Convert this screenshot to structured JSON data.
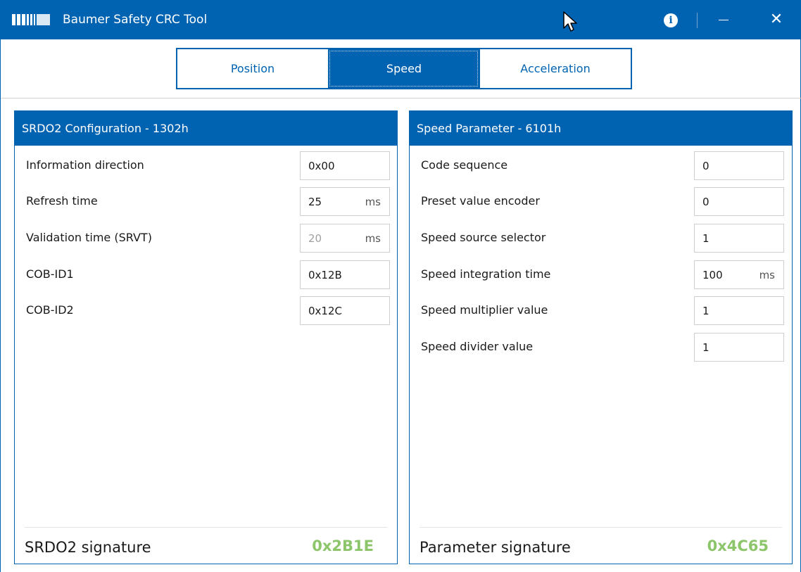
{
  "window": {
    "title": "Baumer Safety CRC Tool",
    "accent_color": "#0063b1",
    "icons": [
      "app-logo-icon",
      "info-icon",
      "minimize-icon",
      "close-icon",
      "mouse-cursor-icon"
    ]
  },
  "tabs": [
    {
      "label": "Position",
      "active": false
    },
    {
      "label": "Speed",
      "active": true
    },
    {
      "label": "Acceleration",
      "active": false
    }
  ],
  "left_panel": {
    "title": "SRDO2 Configuration - 1302h",
    "rows": [
      {
        "label": "Information direction",
        "value": "0x00",
        "unit": ""
      },
      {
        "label": "Refresh time",
        "value": "25",
        "unit": "ms"
      },
      {
        "label": "Validation time (SRVT)",
        "value": "20",
        "unit": "ms",
        "disabled": true
      },
      {
        "label": "COB-ID1",
        "value": "0x12B",
        "unit": ""
      },
      {
        "label": "COB-ID2",
        "value": "0x12C",
        "unit": ""
      }
    ],
    "signature_label": "SRDO2 signature",
    "signature_value": "0x2B1E",
    "signature_color": "#8cc56a"
  },
  "right_panel": {
    "title": "Speed Parameter - 6101h",
    "rows": [
      {
        "label": "Code sequence",
        "value": "0",
        "unit": ""
      },
      {
        "label": "Preset value encoder",
        "value": "0",
        "unit": ""
      },
      {
        "label": "Speed source selector",
        "value": "1",
        "unit": ""
      },
      {
        "label": "Speed integration time",
        "value": "100",
        "unit": "ms"
      },
      {
        "label": "Speed multiplier value",
        "value": "1",
        "unit": ""
      },
      {
        "label": "Speed divider value",
        "value": "1",
        "unit": ""
      }
    ],
    "signature_label": "Parameter signature",
    "signature_value": "0x4C65",
    "signature_color": "#8cc56a"
  }
}
